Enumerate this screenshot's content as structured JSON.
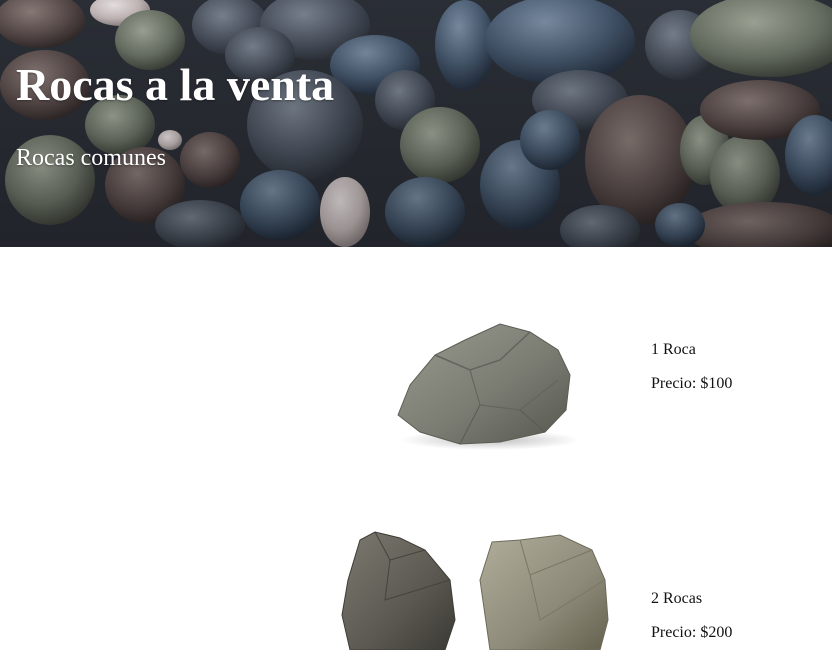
{
  "header": {
    "title": "Rocas a la venta",
    "subtitle": "Rocas comunes",
    "background": "pebbles-photo"
  },
  "products": [
    {
      "image": "single-rock-photo",
      "name": "1 Roca",
      "price_label": "Precio: $100"
    },
    {
      "image": "two-rocks-photo",
      "name": "2 Rocas",
      "price_label": "Precio: $200"
    }
  ],
  "colors": {
    "header_text": "#ffffff",
    "body_text": "#111111",
    "page_background": "#ffffff"
  }
}
